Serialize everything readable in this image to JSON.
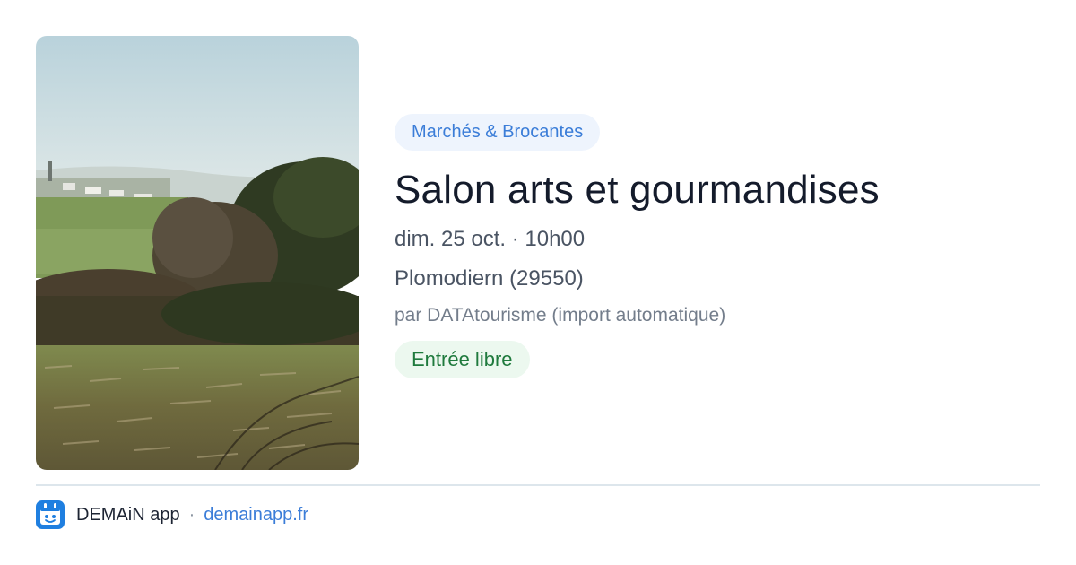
{
  "event": {
    "category": "Marchés & Brocantes",
    "title": "Salon arts et gourmandises",
    "datetime": "dim. 25 oct. · 10h00",
    "location": "Plomodiern (29550)",
    "source": "par DATAtourisme (import automatique)",
    "price": "Entrée libre"
  },
  "footer": {
    "app_name": "DEMAiN app",
    "separator": "·",
    "domain": "demainapp.fr"
  },
  "icons": {
    "app_logo": "demain-app-logo-icon"
  },
  "colors": {
    "accent": "#3b7dd8",
    "category_bg": "#eef4fd",
    "price_text": "#1f7a3d",
    "price_bg": "#ecf8ef",
    "title": "#141b2b"
  }
}
